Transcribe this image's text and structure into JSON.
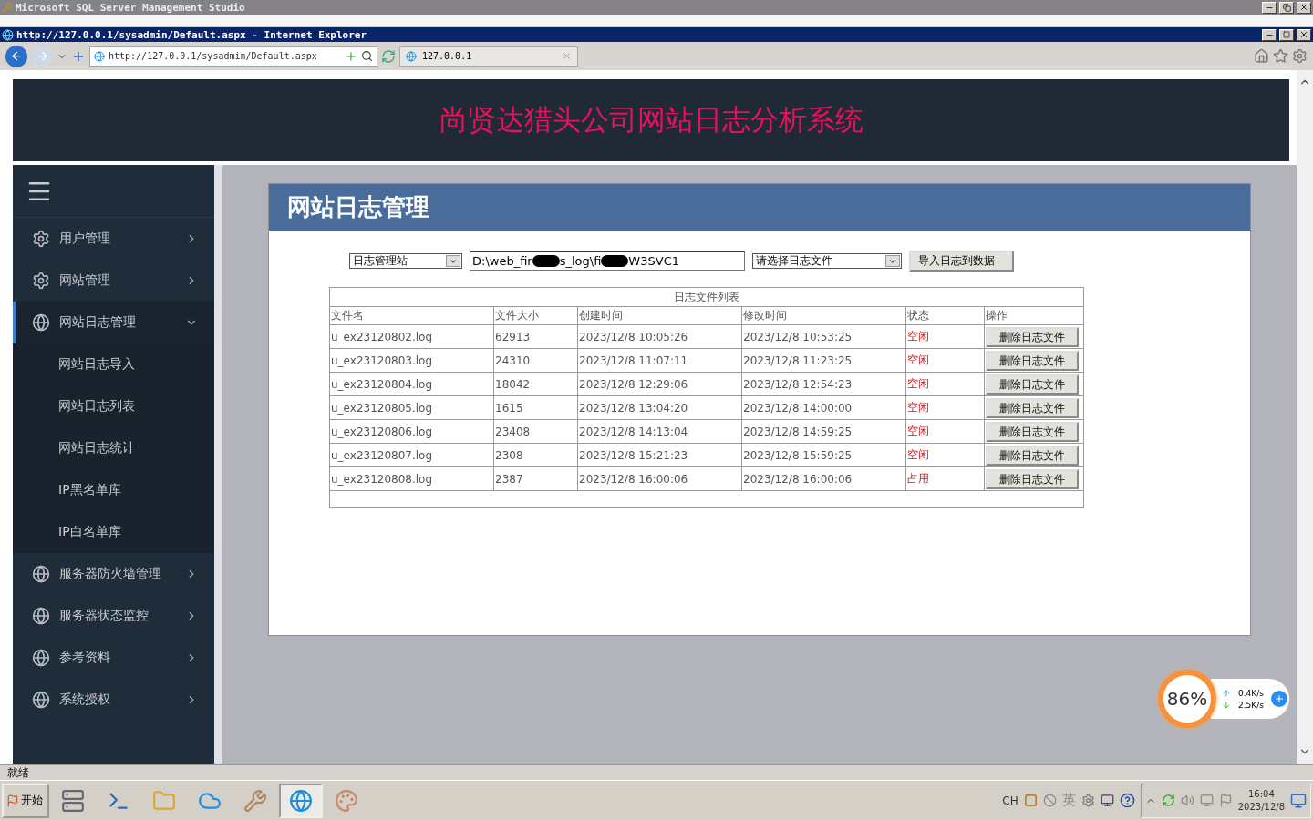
{
  "ssms_window": {
    "title": "Microsoft SQL Server Management Studio"
  },
  "browser": {
    "title": "http://127.0.0.1/sysadmin/Default.aspx - Internet Explorer",
    "address": "http://127.0.0.1/sysadmin/Default.aspx",
    "tab": "127.0.0.1"
  },
  "page": {
    "site_title": "尚贤达猎头公司网站日志分析系统",
    "sidebar": {
      "items": [
        {
          "label": "用户管理",
          "kind": "gear",
          "expanded": false
        },
        {
          "label": "网站管理",
          "kind": "gear",
          "expanded": false
        },
        {
          "label": "网站日志管理",
          "kind": "globe",
          "expanded": true,
          "children": [
            {
              "label": "网站日志导入"
            },
            {
              "label": "网站日志列表"
            },
            {
              "label": "网站日志统计"
            },
            {
              "label": "IP黑名单库"
            },
            {
              "label": "IP白名单库"
            }
          ]
        },
        {
          "label": "服务器防火墙管理",
          "kind": "globe",
          "expanded": false
        },
        {
          "label": "服务器状态监控",
          "kind": "globe",
          "expanded": false
        },
        {
          "label": "参考资料",
          "kind": "globe",
          "expanded": false
        },
        {
          "label": "系统授权",
          "kind": "globe",
          "expanded": false
        }
      ]
    },
    "panel": {
      "title": "网站日志管理",
      "site_select": "日志管理站",
      "path_field_parts": [
        "D:\\web_fir",
        "s_log\\fi",
        "W3SVC1"
      ],
      "file_select": "请选择日志文件",
      "import_button": "导入日志到数据",
      "table": {
        "caption": "日志文件列表",
        "columns": [
          "文件名",
          "文件大小",
          "创建时间",
          "修改时间",
          "状态",
          "操作"
        ],
        "rows": [
          {
            "name": "u_ex23120802.log",
            "size": "62913",
            "created": "2023/12/8 10:05:26",
            "modified": "2023/12/8 10:53:25",
            "status": "空闲",
            "action": "删除日志文件"
          },
          {
            "name": "u_ex23120803.log",
            "size": "24310",
            "created": "2023/12/8 11:07:11",
            "modified": "2023/12/8 11:23:25",
            "status": "空闲",
            "action": "删除日志文件"
          },
          {
            "name": "u_ex23120804.log",
            "size": "18042",
            "created": "2023/12/8 12:29:06",
            "modified": "2023/12/8 12:54:23",
            "status": "空闲",
            "action": "删除日志文件"
          },
          {
            "name": "u_ex23120805.log",
            "size": "1615",
            "created": "2023/12/8 13:04:20",
            "modified": "2023/12/8 14:00:00",
            "status": "空闲",
            "action": "删除日志文件"
          },
          {
            "name": "u_ex23120806.log",
            "size": "23408",
            "created": "2023/12/8 14:13:04",
            "modified": "2023/12/8 14:59:25",
            "status": "空闲",
            "action": "删除日志文件"
          },
          {
            "name": "u_ex23120807.log",
            "size": "2308",
            "created": "2023/12/8 15:21:23",
            "modified": "2023/12/8 15:59:25",
            "status": "空闲",
            "action": "删除日志文件"
          },
          {
            "name": "u_ex23120808.log",
            "size": "2387",
            "created": "2023/12/8 16:00:06",
            "modified": "2023/12/8 16:00:06",
            "status": "占用",
            "action": "删除日志文件"
          }
        ]
      }
    }
  },
  "net_widget": {
    "percent": "86%",
    "upload": "0.4K/s",
    "download": "2.5K/s"
  },
  "status_bar": {
    "text": "就绪"
  },
  "taskbar": {
    "start": "开始",
    "apps": [
      {
        "selected": false
      },
      {
        "selected": false
      },
      {
        "selected": false
      },
      {
        "selected": false
      },
      {
        "selected": false
      },
      {
        "selected": true
      },
      {
        "selected": false
      }
    ],
    "language": "CH",
    "ime": "英",
    "time": "16:04",
    "date": "2023/12/8"
  }
}
